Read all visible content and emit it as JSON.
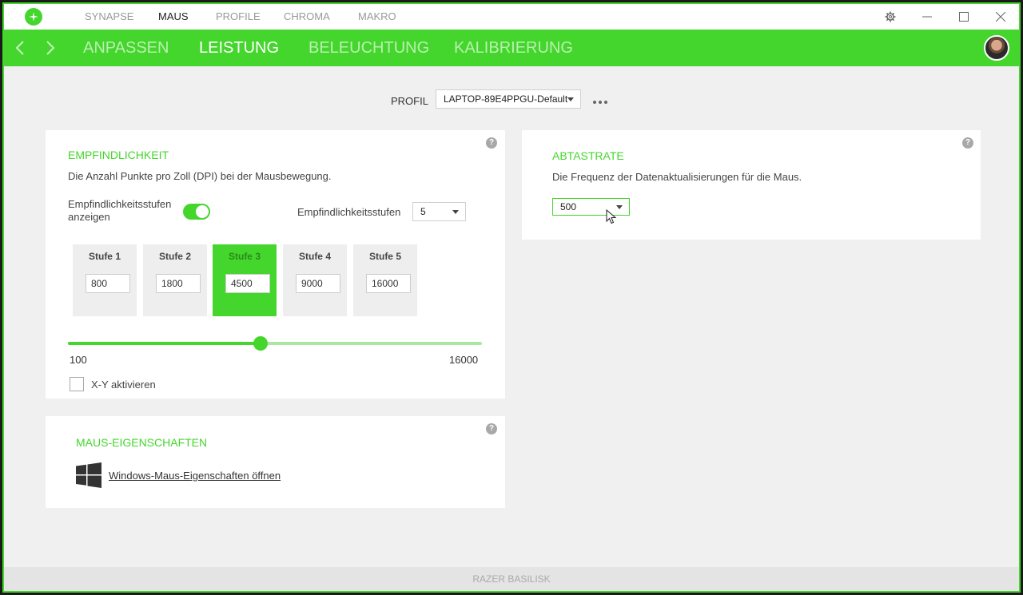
{
  "titlebar": {
    "nav": [
      "SYNAPSE",
      "MAUS",
      "PROFILE",
      "CHROMA",
      "MAKRO"
    ],
    "active": "MAUS",
    "icons": [
      "gear-icon",
      "minimize-icon",
      "maximize-icon",
      "close-icon"
    ]
  },
  "subnav": {
    "tabs": [
      "ANPASSEN",
      "LEISTUNG",
      "BELEUCHTUNG",
      "KALIBRIERUNG"
    ],
    "active": "LEISTUNG"
  },
  "profile": {
    "label": "PROFIL",
    "value": "LAPTOP-89E4PPGU-Default"
  },
  "sensitivity": {
    "title": "EMPFINDLICHKEIT",
    "description": "Die Anzahl Punkte pro Zoll (DPI) bei der Mausbewegung.",
    "show_stages_label_line1": "Empfindlichkeitsstufen",
    "show_stages_label_line2": "anzeigen",
    "show_stages_enabled": true,
    "stage_count_label": "Empfindlichkeitsstufen",
    "stage_count_value": "5",
    "stages": [
      {
        "label": "Stufe 1",
        "value": "800"
      },
      {
        "label": "Stufe 2",
        "value": "1800"
      },
      {
        "label": "Stufe 3",
        "value": "4500"
      },
      {
        "label": "Stufe 4",
        "value": "9000"
      },
      {
        "label": "Stufe 5",
        "value": "16000"
      }
    ],
    "active_stage": 3,
    "slider_min": "100",
    "slider_max": "16000",
    "slider_value": 4500,
    "xy_label": "X-Y aktivieren",
    "xy_enabled": false
  },
  "polling": {
    "title": "ABTASTRATE",
    "description": "Die Frequenz der Datenaktualisierungen für die Maus.",
    "value": "500"
  },
  "mouse_props": {
    "title": "MAUS-EIGENSCHAFTEN",
    "link": "Windows-Maus-Eigenschaften öffnen"
  },
  "statusbar": {
    "device": "RAZER BASILISK"
  },
  "colors": {
    "accent": "#44d62c"
  }
}
